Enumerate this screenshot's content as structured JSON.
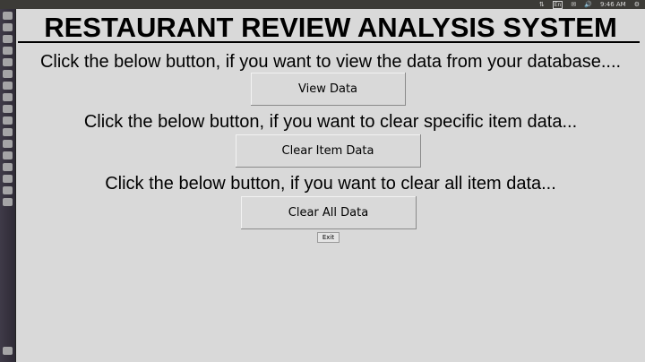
{
  "system_tray": {
    "language": "En",
    "time": "9:46 AM"
  },
  "app": {
    "title": "RESTAURANT REVIEW ANALYSIS SYSTEM",
    "view_prompt": "Click the below button, if you want to view the data from your database....",
    "view_button": "View Data",
    "clear_item_prompt": "Click the below button, if you want to clear specific item data...",
    "clear_item_button": "Clear Item Data",
    "clear_all_prompt": "Click the below button, if you want to clear all item data...",
    "clear_all_button": "Clear All Data",
    "exit_button": "Exit"
  }
}
